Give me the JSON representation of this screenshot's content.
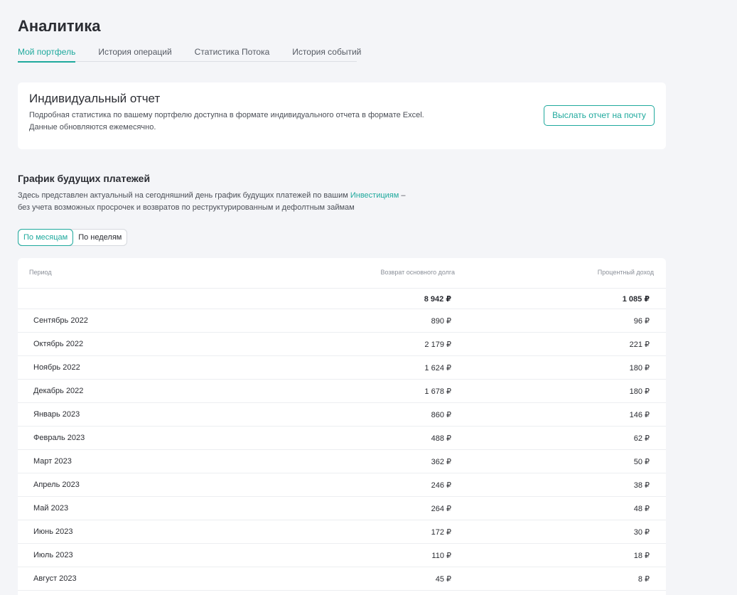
{
  "page": {
    "title": "Аналитика",
    "tabs": [
      "Мой портфель",
      "История операций",
      "Статистика Потока",
      "История событий"
    ]
  },
  "report": {
    "title": "Индивидуальный отчет",
    "line1": "Подробная статистика по вашему портфелю доступна в формате индивидуального отчета в формате Excel.",
    "line2": "Данные обновляются ежемесячно.",
    "button": "Выслать отчет на почту"
  },
  "schedule": {
    "title": "График будущих платежей",
    "line1_before": "Здесь представлен актуальный на сегодняшний день график будущих платежей по вашим ",
    "line1_link": "Инвестициям",
    "line1_after": " –",
    "line2": "без учета возможных просрочек и возвратов по реструктурированным и дефолтным займам",
    "toggle": [
      "По месяцам",
      "По неделям"
    ]
  },
  "table": {
    "headers": {
      "period": "Период",
      "principal": "Возврат основного долга",
      "interest": "Процентный доход"
    },
    "total": {
      "principal": "8 942 ₽",
      "interest": "1 085 ₽"
    },
    "rows": [
      {
        "period": "Сентябрь 2022",
        "principal": "890 ₽",
        "interest": "96 ₽"
      },
      {
        "period": "Октябрь 2022",
        "principal": "2 179 ₽",
        "interest": "221 ₽"
      },
      {
        "period": "Ноябрь 2022",
        "principal": "1 624 ₽",
        "interest": "180 ₽"
      },
      {
        "period": "Декабрь 2022",
        "principal": "1 678 ₽",
        "interest": "180 ₽"
      },
      {
        "period": "Январь 2023",
        "principal": "860 ₽",
        "interest": "146 ₽"
      },
      {
        "period": "Февраль 2023",
        "principal": "488 ₽",
        "interest": "62 ₽"
      },
      {
        "period": "Март 2023",
        "principal": "362 ₽",
        "interest": "50 ₽"
      },
      {
        "period": "Апрель 2023",
        "principal": "246 ₽",
        "interest": "38 ₽"
      },
      {
        "period": "Май 2023",
        "principal": "264 ₽",
        "interest": "48 ₽"
      },
      {
        "period": "Июнь 2023",
        "principal": "172 ₽",
        "interest": "30 ₽"
      },
      {
        "period": "Июль 2023",
        "principal": "110 ₽",
        "interest": "18 ₽"
      },
      {
        "period": "Август 2023",
        "principal": "45 ₽",
        "interest": "8 ₽"
      }
    ]
  },
  "colors": {
    "accent": "#1fa99d",
    "background": "#f4f5f8",
    "card": "#ffffff"
  }
}
